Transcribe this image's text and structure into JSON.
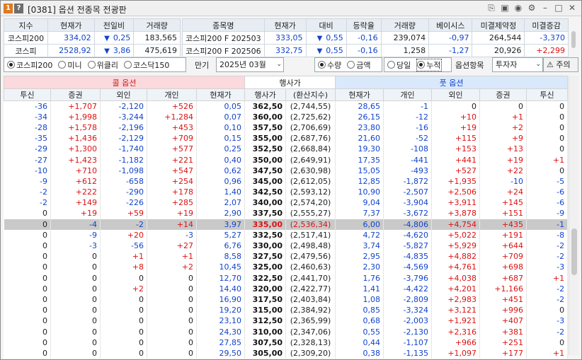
{
  "window": {
    "num": "1",
    "help": "?",
    "title": "[0381] 옵션 전종목 전광판"
  },
  "summary_left": {
    "headers": [
      "지수",
      "현재가",
      "전일비",
      "거래량"
    ],
    "rows": [
      {
        "name": "코스피200",
        "price": "334,02",
        "chg": "0,25",
        "vol": "183,565"
      },
      {
        "name": "코스피",
        "price": "2528,92",
        "chg": "3,86",
        "vol": "475,619"
      }
    ]
  },
  "summary_right": {
    "headers": [
      "종목명",
      "현재가",
      "대비",
      "등락율",
      "거래량",
      "베이시스",
      "미결제약정",
      "미결증감"
    ],
    "rows": [
      {
        "name": "코스피200 F 202503",
        "price": "333,05",
        "chg": "0,55",
        "rate": "-0,16",
        "vol": "239,074",
        "basis": "-0,97",
        "oi": "264,544",
        "oichg": "-3,370"
      },
      {
        "name": "코스피200 F 202506",
        "price": "332,75",
        "chg": "0,55",
        "rate": "-0,16",
        "vol": "1,258",
        "basis": "-1,27",
        "oi": "20,926",
        "oichg": "+2,299"
      }
    ]
  },
  "controls": {
    "index_opts": [
      "코스피200",
      "미니",
      "위클리",
      "코스닥150"
    ],
    "expiry_label": "만기",
    "expiry_value": "2025년 03월",
    "qty_opts": [
      "수량",
      "금액"
    ],
    "day_opts": [
      "당일",
      "누적"
    ],
    "option_label": "옵션항목",
    "option_value": "투자자",
    "notice_btn": "주의"
  },
  "grid": {
    "call_title": "콜 옵션",
    "mid_title": "행사가",
    "put_title": "풋 옵션",
    "cols": [
      "투신",
      "증권",
      "외인",
      "개인",
      "현재가",
      "행사가",
      "(환산지수)",
      "현재가",
      "개인",
      "외인",
      "증권",
      "투신"
    ],
    "rows": [
      [
        "-36",
        "+1,707",
        "-2,120",
        "+526",
        "0,05",
        "362,50",
        "(2,744,55)",
        "28,65",
        "-1",
        "0",
        "0",
        "0"
      ],
      [
        "-34",
        "+1,998",
        "-3,244",
        "+1,284",
        "0,07",
        "360,00",
        "(2,725,62)",
        "26,15",
        "-12",
        "+10",
        "+1",
        "0"
      ],
      [
        "-28",
        "+1,578",
        "-2,196",
        "+453",
        "0,10",
        "357,50",
        "(2,706,69)",
        "23,80",
        "-16",
        "+19",
        "+2",
        "0"
      ],
      [
        "-35",
        "+1,436",
        "-2,129",
        "+709",
        "0,15",
        "355,00",
        "(2,687,76)",
        "21,60",
        "-52",
        "+115",
        "+9",
        "0"
      ],
      [
        "-29",
        "+1,300",
        "-1,740",
        "+577",
        "0,25",
        "352,50",
        "(2,668,84)",
        "19,30",
        "-108",
        "+153",
        "+13",
        "0"
      ],
      [
        "-27",
        "+1,423",
        "-1,182",
        "+221",
        "0,40",
        "350,00",
        "(2,649,91)",
        "17,35",
        "-441",
        "+441",
        "+19",
        "+1"
      ],
      [
        "-10",
        "+710",
        "-1,098",
        "+547",
        "0,62",
        "347,50",
        "(2,630,98)",
        "15,05",
        "-493",
        "+527",
        "+22",
        "0"
      ],
      [
        "-9",
        "+612",
        "-658",
        "+254",
        "0,96",
        "345,00",
        "(2,612,05)",
        "12,85",
        "-1,872",
        "+1,935",
        "-10",
        "-5"
      ],
      [
        "-2",
        "+222",
        "-290",
        "+178",
        "1,40",
        "342,50",
        "(2,593,12)",
        "10,90",
        "-2,507",
        "+2,506",
        "+24",
        "-6"
      ],
      [
        "-2",
        "+149",
        "-226",
        "+285",
        "2,07",
        "340,00",
        "(2,574,20)",
        "9,04",
        "-3,904",
        "+3,911",
        "+145",
        "-6"
      ],
      [
        "0",
        "+19",
        "+59",
        "+19",
        "2,90",
        "337,50",
        "(2,555,27)",
        "7,37",
        "-3,672",
        "+3,878",
        "+151",
        "-9"
      ],
      [
        "0",
        "-4",
        "-2",
        "+14",
        "3,97",
        "335,00",
        "(2,536,34)",
        "6,00",
        "-4,806",
        "+4,754",
        "+435",
        "-1"
      ],
      [
        "0",
        "-9",
        "+20",
        "-3",
        "5,27",
        "332,50",
        "(2,517,41)",
        "4,72",
        "-4,620",
        "+5,022",
        "+191",
        "-8"
      ],
      [
        "0",
        "-3",
        "-56",
        "+27",
        "6,76",
        "330,00",
        "(2,498,48)",
        "3,74",
        "-5,827",
        "+5,929",
        "+644",
        "-2"
      ],
      [
        "0",
        "0",
        "+1",
        "+1",
        "8,58",
        "327,50",
        "(2,479,56)",
        "2,95",
        "-4,835",
        "+4,882",
        "+709",
        "-2"
      ],
      [
        "0",
        "0",
        "+8",
        "+2",
        "10,45",
        "325,00",
        "(2,460,63)",
        "2,30",
        "-4,569",
        "+4,761",
        "+698",
        "-3"
      ],
      [
        "0",
        "0",
        "0",
        "0",
        "12,70",
        "322,50",
        "(2,441,70)",
        "1,76",
        "-3,796",
        "+4,038",
        "+687",
        "+1"
      ],
      [
        "0",
        "0",
        "+2",
        "0",
        "14,40",
        "320,00",
        "(2,422,77)",
        "1,41",
        "-4,422",
        "+4,201",
        "+1,166",
        "-2"
      ],
      [
        "0",
        "0",
        "0",
        "0",
        "16,90",
        "317,50",
        "(2,403,84)",
        "1,08",
        "-2,809",
        "+2,983",
        "+451",
        "-2"
      ],
      [
        "0",
        "0",
        "0",
        "0",
        "19,20",
        "315,00",
        "(2,384,92)",
        "0,85",
        "-3,324",
        "+3,121",
        "+996",
        "0"
      ],
      [
        "0",
        "0",
        "0",
        "0",
        "23,10",
        "312,50",
        "(2,365,99)",
        "0,68",
        "-2,003",
        "+1,921",
        "+407",
        "-3"
      ],
      [
        "0",
        "0",
        "0",
        "0",
        "24,30",
        "310,00",
        "(2,347,06)",
        "0,55",
        "-2,130",
        "+2,316",
        "+381",
        "-2"
      ],
      [
        "0",
        "0",
        "0",
        "0",
        "27,85",
        "307,50",
        "(2,328,13)",
        "0,44",
        "-1,107",
        "+966",
        "+251",
        "0"
      ],
      [
        "0",
        "0",
        "0",
        "0",
        "29,50",
        "305,00",
        "(2,309,20)",
        "0,38",
        "-1,135",
        "+1,097",
        "+177",
        "+1"
      ]
    ],
    "atm_row": 11
  },
  "colors": {
    "up": "#dd1111",
    "down": "#1144cc",
    "call_bg": "#fbd9dc",
    "put_bg": "#d9e9fb"
  }
}
